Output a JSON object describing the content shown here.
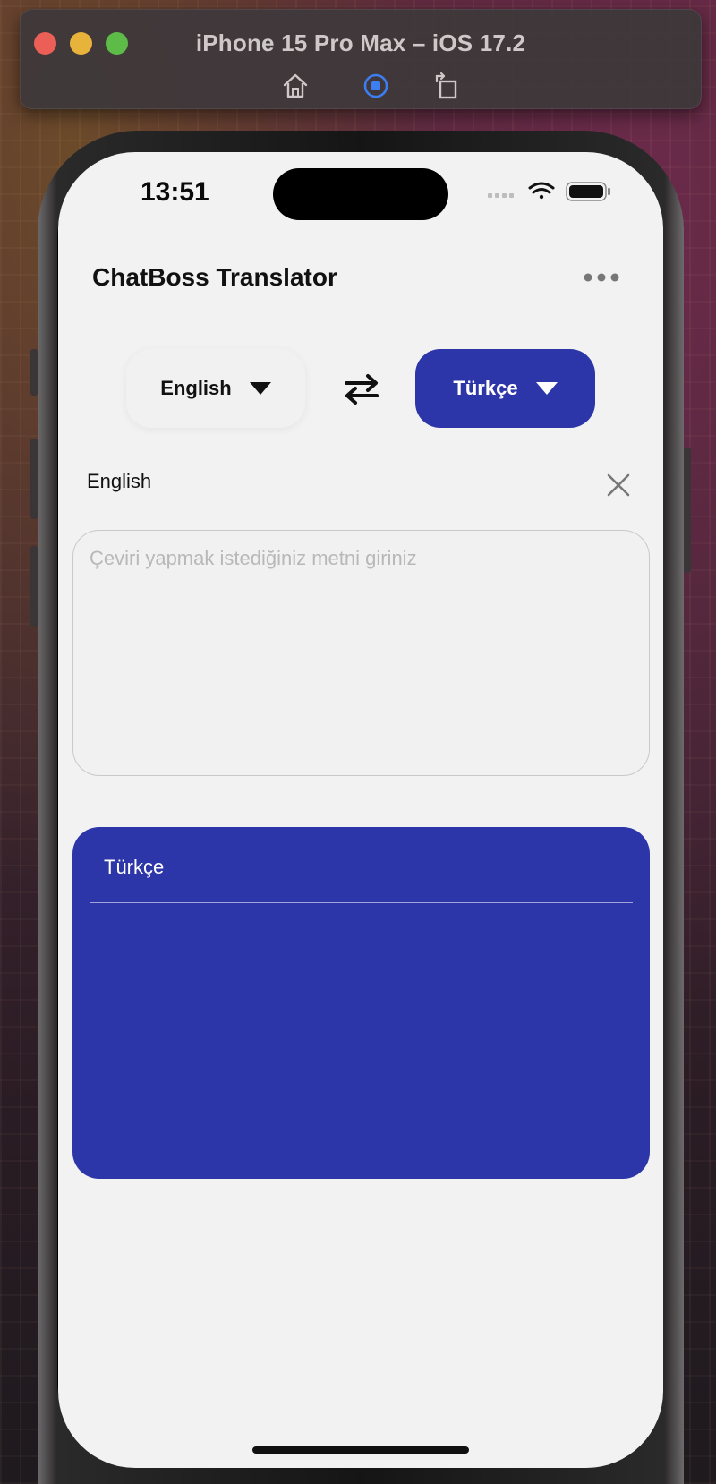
{
  "simulator": {
    "title": "iPhone 15 Pro Max – iOS 17.2",
    "icons": [
      "home-icon",
      "screenshot-icon",
      "rotate-icon"
    ]
  },
  "status_bar": {
    "time": "13:51",
    "icons": [
      "signal-icon",
      "wifi-icon",
      "battery-icon"
    ]
  },
  "app": {
    "title": "ChatBoss Translator",
    "menu_icon": "more-horizontal-icon"
  },
  "languages": {
    "source": "English",
    "target": "Türkçe",
    "swap_icon": "swap-arrows-icon"
  },
  "input": {
    "language_label": "English",
    "placeholder": "Çeviri yapmak istediğiniz metni giriniz",
    "value": ""
  },
  "output": {
    "language_label": "Türkçe",
    "value": ""
  },
  "colors": {
    "accent": "#2d36a8",
    "screen_bg": "#f2f2f2"
  }
}
